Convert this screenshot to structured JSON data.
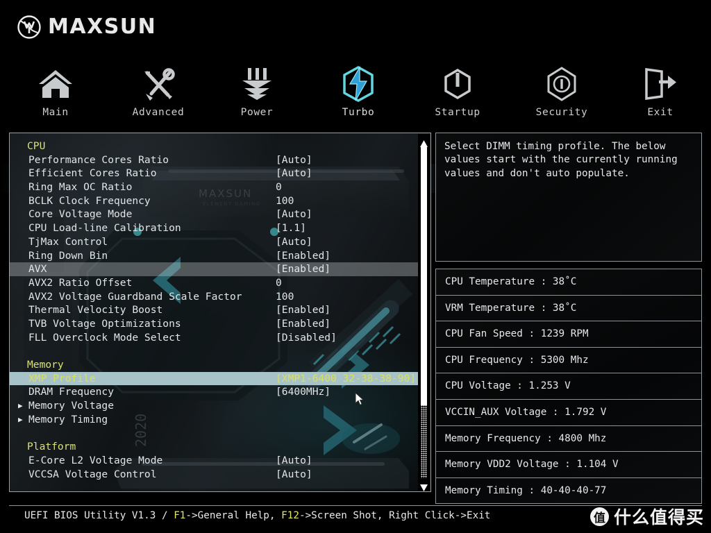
{
  "brand": {
    "name": "MAXSUN",
    "logo_icon": "maxsun-globe-logo"
  },
  "nav": {
    "items": [
      {
        "label": "Main",
        "icon": "home-icon",
        "active": false
      },
      {
        "label": "Advanced",
        "icon": "tools-icon",
        "active": false
      },
      {
        "label": "Power",
        "icon": "power-stack-icon",
        "active": false
      },
      {
        "label": "Turbo",
        "icon": "lightning-hex-icon",
        "active": true
      },
      {
        "label": "Startup",
        "icon": "power-button-icon",
        "active": false
      },
      {
        "label": "Security",
        "icon": "shield-info-icon",
        "active": false
      },
      {
        "label": "Exit",
        "icon": "exit-arrow-icon",
        "active": false
      }
    ]
  },
  "settings": {
    "rows": [
      {
        "type": "section",
        "label": "CPU"
      },
      {
        "type": "item",
        "label": "Performance Cores Ratio",
        "value": "[Auto]"
      },
      {
        "type": "item",
        "label": "Efficient Cores Ratio",
        "value": "[Auto]"
      },
      {
        "type": "item",
        "label": "Ring Max OC Ratio",
        "value": "0"
      },
      {
        "type": "item",
        "label": "BCLK Clock Frequency",
        "value": "100"
      },
      {
        "type": "item",
        "label": "Core Voltage Mode",
        "value": "[Auto]"
      },
      {
        "type": "item",
        "label": "CPU Load-line Calibration",
        "value": "[1.1]"
      },
      {
        "type": "item",
        "label": "TjMax Control",
        "value": "[Auto]"
      },
      {
        "type": "item",
        "label": "Ring Down Bin",
        "value": "[Enabled]"
      },
      {
        "type": "item",
        "label": "AVX",
        "value": "[Enabled]",
        "state": "hover"
      },
      {
        "type": "item",
        "label": "AVX2 Ratio Offset",
        "value": "0"
      },
      {
        "type": "item",
        "label": "AVX2 Voltage Guardband Scale Factor",
        "value": "100"
      },
      {
        "type": "item",
        "label": "Thermal Velocity Boost",
        "value": "[Enabled]"
      },
      {
        "type": "item",
        "label": "TVB Voltage Optimizations",
        "value": "[Enabled]"
      },
      {
        "type": "item",
        "label": "FLL Overclock Mode Select",
        "value": "[Disabled]"
      },
      {
        "type": "spacer"
      },
      {
        "type": "section",
        "label": "Memory"
      },
      {
        "type": "item",
        "label": "XMP Profile",
        "value": "[XMP1-6400 32-38-38-90]",
        "state": "selected"
      },
      {
        "type": "item",
        "label": "DRAM Frequency",
        "value": "[6400MHz]"
      },
      {
        "type": "item",
        "label": "Memory Voltage",
        "value": "",
        "submenu": true
      },
      {
        "type": "item",
        "label": "Memory Timing",
        "value": "",
        "submenu": true
      },
      {
        "type": "spacer"
      },
      {
        "type": "section",
        "label": "Platform"
      },
      {
        "type": "item",
        "label": "E-Core L2 Voltage Mode",
        "value": "[Auto]"
      },
      {
        "type": "item",
        "label": "VCCSA Voltage Control",
        "value": "[Auto]"
      }
    ]
  },
  "help": {
    "text": "Select DIMM timing profile. The below\nvalues start with the currently running\nvalues and don't auto populate."
  },
  "sensors": [
    {
      "label": "CPU Temperature : 38˚C"
    },
    {
      "label": "VRM Temperature : 38˚C"
    },
    {
      "label": "CPU Fan Speed : 1239 RPM"
    },
    {
      "label": "CPU Frequency : 5300 Mhz"
    },
    {
      "label": "CPU Voltage : 1.253 V"
    },
    {
      "label": "VCCIN_AUX Voltage : 1.792 V"
    },
    {
      "label": "Memory Frequency : 4800 Mhz"
    },
    {
      "label": "Memory VDD2 Voltage : 1.104 V"
    },
    {
      "label": "Memory Timing : 40-40-40-77"
    }
  ],
  "footer": {
    "prefix": "UEFI BIOS Utility V1.3 / ",
    "key1": "F1",
    "mid1": "->General Help, ",
    "key2": "F12",
    "mid2": "->Screen Shot, Right Click->Exit"
  },
  "watermark": {
    "badge": "值",
    "text": "什么值得买"
  },
  "colors": {
    "section_heading": "#d9e07a",
    "selected_row_bg": "#a8c3c7",
    "selected_row_text": "#d8e05e",
    "hover_row_bg": "rgba(205,210,214,0.34)",
    "accent_turbo": "#53c8d8",
    "body_text": "#e3e6e8",
    "footer_key": "#e1e85f"
  },
  "scroll": {
    "thumb_top_pct": 0,
    "thumb_height_pct": 78
  }
}
